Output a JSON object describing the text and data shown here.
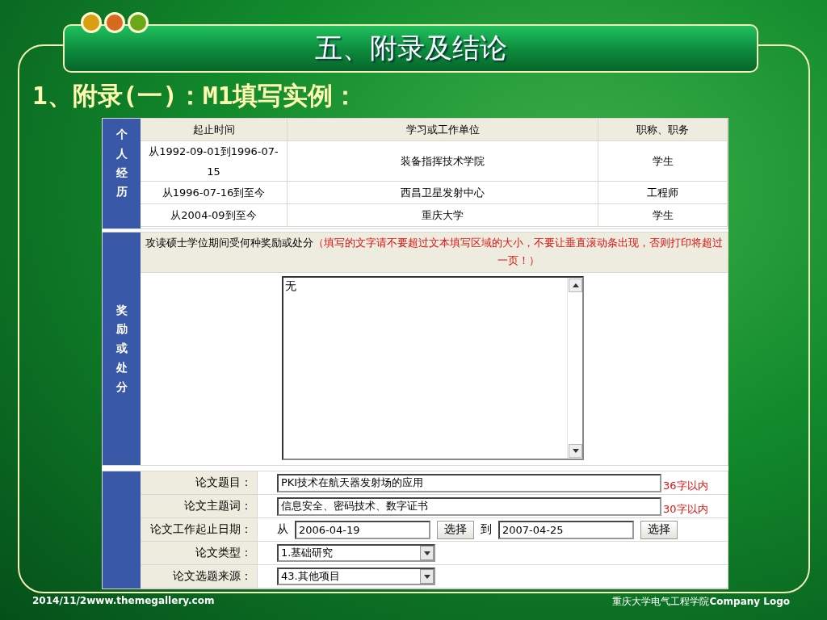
{
  "slide": {
    "title": "五、附录及结论",
    "subtitle": "1、附录(一)：M1填写实例：",
    "footer_left": "2014/11/2www.themegallery.com",
    "footer_right": "重庆大学电气工程学院**Company Logo**"
  },
  "experience": {
    "side_label": "个人经历",
    "columns": [
      "起止时间",
      "学习或工作单位",
      "职称、职务"
    ],
    "rows": [
      [
        "从1992-09-01到1996-07-15",
        "装备指挥技术学院",
        "学生"
      ],
      [
        "从1996-07-16到至今",
        "西昌卫星发射中心",
        "工程师"
      ],
      [
        "从2004-09到至今",
        "重庆大学",
        "学生"
      ]
    ]
  },
  "awards": {
    "side_label": "奖励或处分",
    "prompt": "攻读硕士学位期间受何种奖励或处分",
    "warning": "（填写的文字请不要超过文本填写区域的大小，不要让垂直滚动条出现，否则打印将超过一页！）",
    "value": "无"
  },
  "thesis": {
    "fields": [
      {
        "kind": "text",
        "label": "论文题目：",
        "value": "PKI技术在航天器发射场的应用",
        "note": "36字以内"
      },
      {
        "kind": "text",
        "label": "论文主题词：",
        "value": "信息安全、密码技术、数字证书",
        "note": "30字以内"
      },
      {
        "kind": "daterange",
        "label": "论文工作起止日期：",
        "from_label": "从",
        "from": "2006-04-19",
        "from_button": "选择",
        "to_label": "到",
        "to": "2007-04-25",
        "to_button": "选择"
      },
      {
        "kind": "select",
        "label": "论文类型：",
        "value": "1.基础研究"
      },
      {
        "kind": "select",
        "label": "论文选题来源：",
        "value": "43.其他项目"
      }
    ]
  }
}
